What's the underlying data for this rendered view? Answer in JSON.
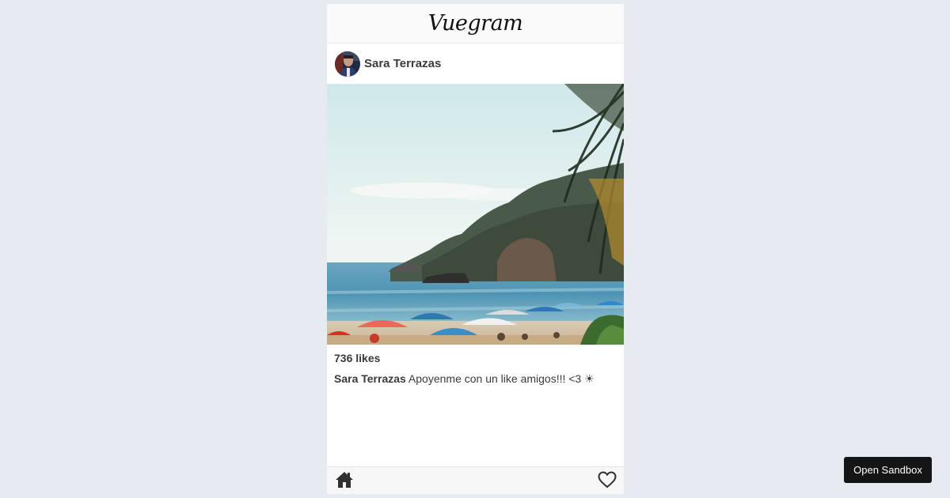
{
  "app": {
    "brand": "Vuegram"
  },
  "post": {
    "username": "Sara Terrazas",
    "likes_text": "736 likes",
    "caption_user": "Sara Terrazas",
    "caption_text": " Apoyenme con un like amigos!!! <3 ☀",
    "image_subject": "beach with umbrellas, sea, rocky hill and palm leaves"
  },
  "nav": {
    "home_icon": "home-icon",
    "heart_icon": "heart-icon"
  },
  "sandbox": {
    "label": "Open Sandbox"
  },
  "colors": {
    "page_bg": "#e6ebf2",
    "header_bg": "#fafafa",
    "text": "#3a3a3a",
    "sandbox_bg": "#151515"
  }
}
